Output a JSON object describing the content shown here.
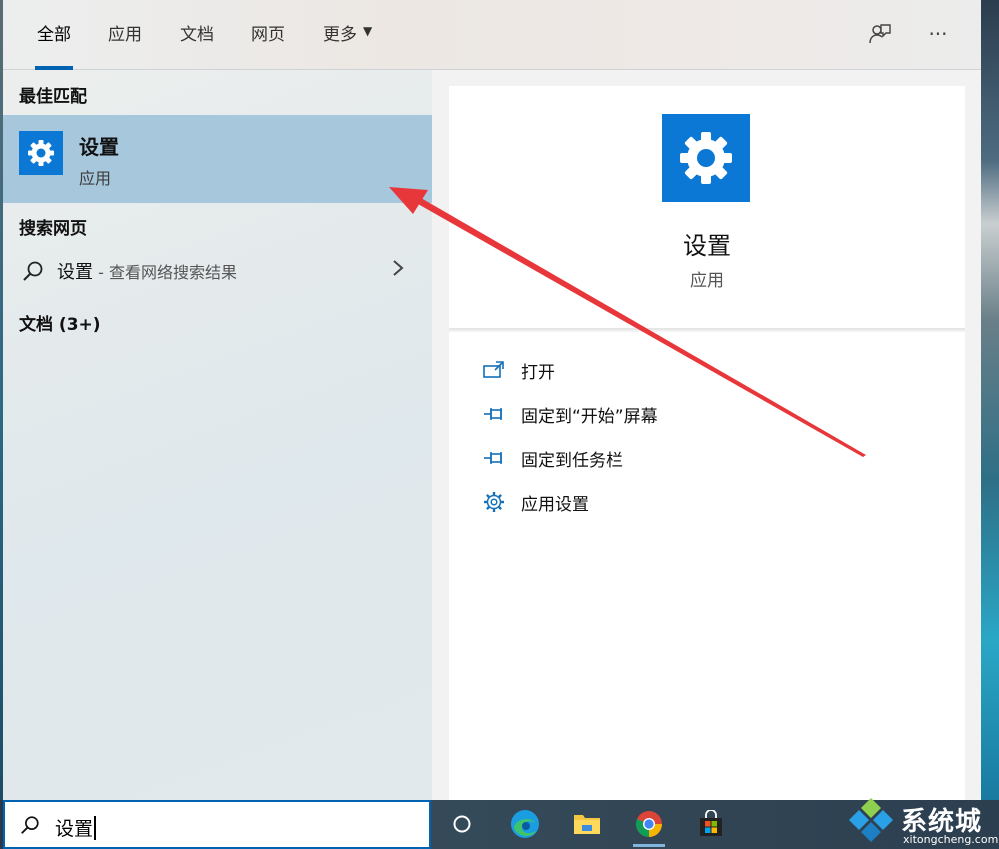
{
  "tabs": [
    {
      "label": "全部",
      "active": true
    },
    {
      "label": "应用",
      "active": false
    },
    {
      "label": "文档",
      "active": false
    },
    {
      "label": "网页",
      "active": false
    },
    {
      "label": "更多",
      "active": false
    }
  ],
  "top_icons": [
    "feedback-icon",
    "more-options-icon"
  ],
  "left": {
    "best_match_heading": "最佳匹配",
    "best_match": {
      "title": "设置",
      "subtitle": "应用",
      "icon": "gear-icon"
    },
    "web_heading": "搜索网页",
    "web_result": {
      "term": "设置",
      "hint": " - 查看网络搜索结果"
    },
    "docs_heading": "文档 (3+)"
  },
  "detail": {
    "title": "设置",
    "subtitle": "应用",
    "icon": "gear-icon",
    "actions": [
      {
        "label": "打开",
        "icon": "open-icon"
      },
      {
        "label": "固定到“开始”屏幕",
        "icon": "pin-icon"
      },
      {
        "label": "固定到任务栏",
        "icon": "pin-icon"
      },
      {
        "label": "应用设置",
        "icon": "gear-outline-icon"
      }
    ]
  },
  "search": {
    "value": "设置",
    "icon": "search-icon"
  },
  "taskbar": {
    "items": [
      "task-view-icon",
      "edge-icon",
      "file-explorer-icon",
      "chrome-icon",
      "store-icon"
    ]
  },
  "watermark": {
    "text": "系统城",
    "url": "xitongcheng.com"
  },
  "colors": {
    "accent": "#0063b1",
    "tile_blue": "#0a78d4",
    "highlight": "#a7c7dc",
    "arrow": "#e8373a"
  }
}
